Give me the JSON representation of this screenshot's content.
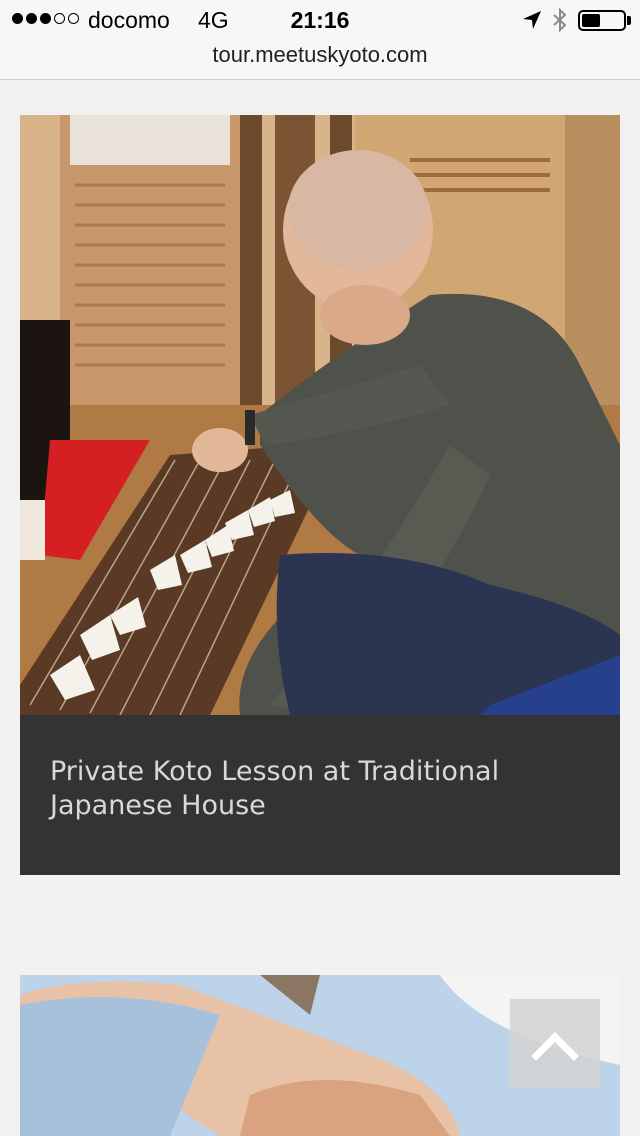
{
  "status_bar": {
    "carrier": "docomo",
    "network": "4G",
    "time": "21:16",
    "signal_bars_filled": 3,
    "signal_bars_total": 5,
    "battery_level": 0.45,
    "icons": [
      "location-arrow-icon",
      "bluetooth-icon",
      "battery-icon"
    ]
  },
  "browser": {
    "url": "tour.meetuskyoto.com"
  },
  "cards": [
    {
      "title": "Private Koto Lesson at Traditional Japanese House",
      "image": "koto-player-photo"
    },
    {
      "image": "hands-photo"
    }
  ],
  "back_to_top": {
    "icon": "chevron-up-icon"
  },
  "colors": {
    "page_background": "#f1f1f1",
    "caption_background": "#333333",
    "caption_text": "#d9d9d9"
  }
}
